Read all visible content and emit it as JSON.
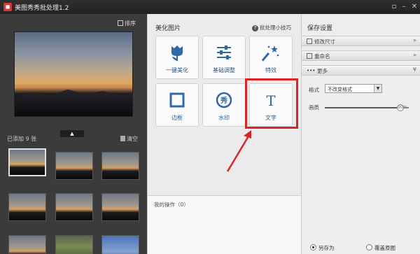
{
  "window": {
    "title": "美图秀秀批处理1.2",
    "controls": [
      "▫",
      "–",
      "✕"
    ]
  },
  "left": {
    "sort_label": "排序",
    "collapse_glyph": "▲",
    "added_count": "已添加 9 张",
    "clear_label": "清空",
    "thumbnails": 9
  },
  "middle": {
    "section_title": "美化图片",
    "tips_label": "批处理小技巧",
    "tools": [
      {
        "label": "一键美化",
        "icon": "tulip-icon"
      },
      {
        "label": "基础调整",
        "icon": "sliders-icon"
      },
      {
        "label": "特效",
        "icon": "magic-wand-icon"
      },
      {
        "label": "边框",
        "icon": "frame-icon"
      },
      {
        "label": "水印",
        "icon": "watermark-icon",
        "glyph": "秀"
      },
      {
        "label": "文字",
        "icon": "text-icon",
        "glyph": "T"
      }
    ],
    "ops_label": "我的操作（0）"
  },
  "right": {
    "section_title": "保存设置",
    "sections": [
      {
        "label": "修改尺寸",
        "arrow": "»"
      },
      {
        "label": "重命名",
        "arrow": "»"
      },
      {
        "label": "更多",
        "arrow": "¥"
      }
    ],
    "format_label": "格式",
    "format_value": "不改变格式",
    "quality_label": "画质",
    "quality_value": "90%",
    "quality_fraction": 0.9,
    "save_as_label": "另存为",
    "overwrite_label": "覆盖原图"
  },
  "colors": {
    "highlight": "#d9252a",
    "tool_icon_blue": "#2f6aa6"
  }
}
